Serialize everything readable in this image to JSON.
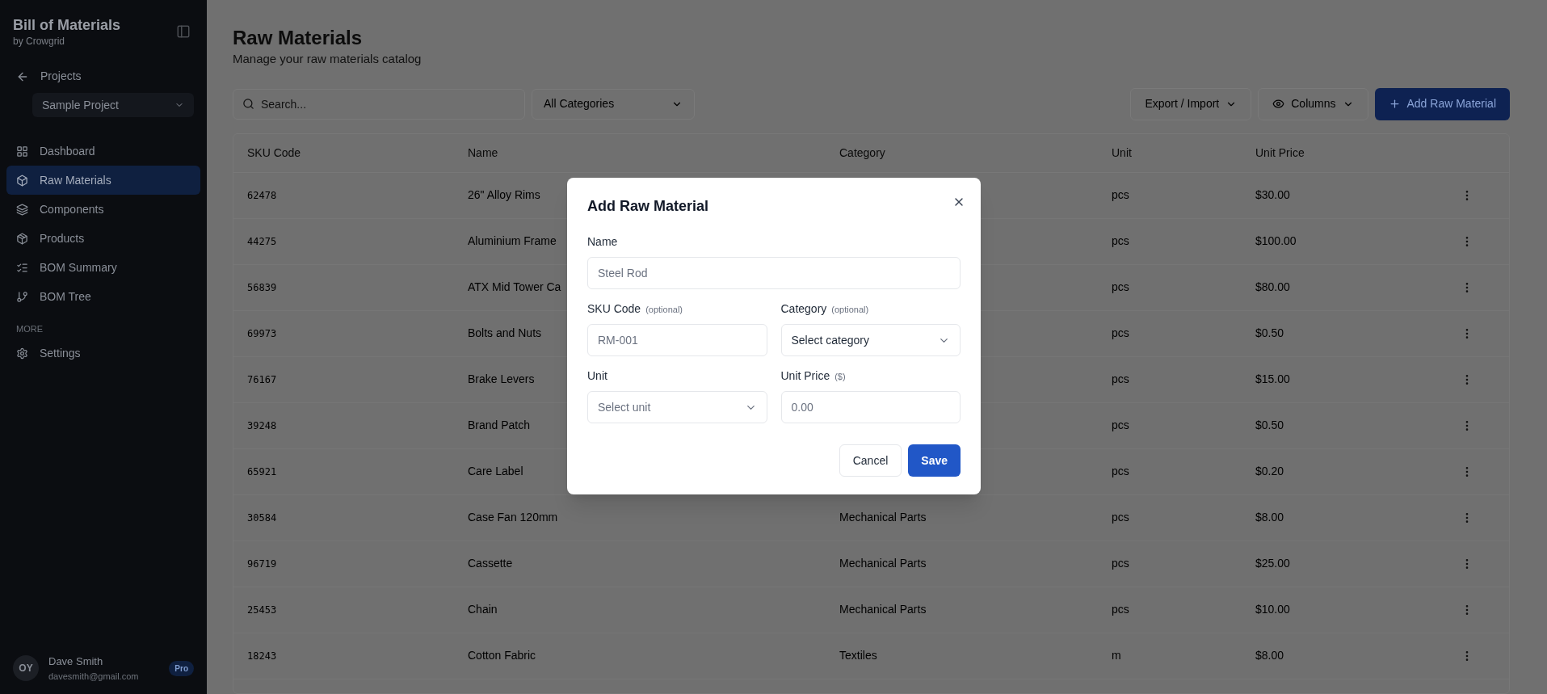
{
  "sidebar": {
    "brand": {
      "title": "Bill of Materials",
      "subtitle": "by Crowgrid"
    },
    "back_link": "Projects",
    "project_select": "Sample Project",
    "nav": [
      {
        "label": "Dashboard",
        "selected": false
      },
      {
        "label": "Raw Materials",
        "selected": true
      },
      {
        "label": "Components",
        "selected": false
      },
      {
        "label": "Products",
        "selected": false
      },
      {
        "label": "BOM Summary",
        "selected": false
      },
      {
        "label": "BOM Tree",
        "selected": false
      }
    ],
    "section_label": "MORE",
    "more_items": [
      {
        "label": "Settings",
        "selected": false
      }
    ],
    "user": {
      "initials": "OY",
      "name": "Dave Smith",
      "email": "davesmith@gmail.com",
      "badge": "Pro"
    }
  },
  "page": {
    "title": "Raw Materials",
    "subtitle": "Manage your raw materials catalog"
  },
  "toolbar": {
    "search": {
      "placeholder": "Search..."
    },
    "category_filter": "All Categories",
    "buttons": [
      {
        "label": "Export / Import",
        "kind": "dropdown"
      },
      {
        "label": "Columns",
        "kind": "columns"
      },
      {
        "label": "Add Raw Material",
        "kind": "primary"
      }
    ]
  },
  "table": {
    "columns": [
      "SKU Code",
      "Name",
      "Category",
      "Unit",
      "Unit Price"
    ],
    "rows": [
      {
        "sku": "62478",
        "name": "26\" Alloy Rims",
        "unit": "pcs",
        "unit_price": "$30.00"
      },
      {
        "sku": "44275",
        "name": "Aluminium Frame",
        "unit": "pcs",
        "unit_price": "$100.00"
      },
      {
        "sku": "56839",
        "name": "ATX Mid Tower Ca",
        "unit": "pcs",
        "unit_price": "$80.00"
      },
      {
        "sku": "69973",
        "name": "Bolts and Nuts",
        "unit": "pcs",
        "unit_price": "$0.50"
      },
      {
        "sku": "76167",
        "name": "Brake Levers",
        "unit": "pcs",
        "unit_price": "$15.00"
      },
      {
        "sku": "39248",
        "name": "Brand Patch",
        "unit": "pcs",
        "unit_price": "$0.50"
      },
      {
        "sku": "65921",
        "name": "Care Label",
        "unit": "pcs",
        "unit_price": "$0.20"
      },
      {
        "sku": "30584",
        "name": "Case Fan 120mm",
        "category": "Mechanical Parts",
        "unit": "pcs",
        "unit_price": "$8.00"
      },
      {
        "sku": "96719",
        "name": "Cassette",
        "category": "Mechanical Parts",
        "unit": "pcs",
        "unit_price": "$25.00"
      },
      {
        "sku": "25453",
        "name": "Chain",
        "category": "Mechanical Parts",
        "unit": "pcs",
        "unit_price": "$10.00"
      },
      {
        "sku": "18243",
        "name": "Cotton Fabric",
        "category": "Textiles",
        "unit": "m",
        "unit_price": "$8.00"
      }
    ]
  },
  "dialog": {
    "title": "Add Raw Material",
    "name_field": {
      "label": "Name",
      "placeholder": "Steel Rod"
    },
    "fields": [
      {
        "label": "SKU Code",
        "hint": "(optional)",
        "kind": "text",
        "placeholder": "RM-001"
      },
      {
        "label": "Category",
        "hint": "(optional)",
        "kind": "select",
        "value": "Select category"
      },
      {
        "label": "Unit",
        "kind": "select",
        "placeholder": "Select unit"
      },
      {
        "label": "Unit Price",
        "hint": "($)",
        "kind": "text",
        "placeholder": "0.00"
      }
    ],
    "buttons": [
      {
        "label": "Cancel",
        "kind": "secondary"
      },
      {
        "label": "Save",
        "kind": "primary"
      }
    ]
  }
}
